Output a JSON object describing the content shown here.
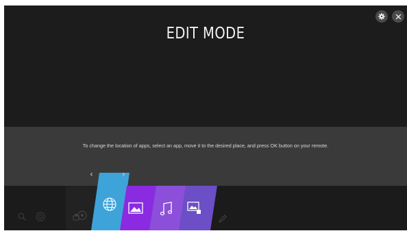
{
  "header": {
    "title": "EDIT MODE",
    "settings_icon": "gear-icon",
    "close_icon": "close-icon"
  },
  "instruction": {
    "text": "To change the location of apps, select an app, move it to the desired place, and press OK button on your remote."
  },
  "move_arrows": {
    "left": "‹",
    "right": "›"
  },
  "launcher": {
    "items": [
      {
        "name": "search",
        "icon": "search-icon"
      },
      {
        "name": "settings",
        "icon": "settings-circle-icon"
      },
      {
        "name": "inputs",
        "icon": "input-hub-icon"
      },
      {
        "name": "web-browser",
        "icon": "globe-icon",
        "color": "#3ea3d8",
        "selected": true
      },
      {
        "name": "photo-video",
        "icon": "image-icon",
        "color": "#8a2be2"
      },
      {
        "name": "music",
        "icon": "music-icon",
        "color": "#8b4fd9"
      },
      {
        "name": "gallery",
        "icon": "photo-gallery-icon",
        "color": "#6c4ec6"
      },
      {
        "name": "edit",
        "icon": "pencil-icon"
      }
    ]
  },
  "colors": {
    "background": "#1c1c1c",
    "instruction_band": "#3a3a3a",
    "launcher_bar": "#1b1b1b",
    "browser_card": "#3ea3d8",
    "photo_card": "#8a2be2",
    "music_card": "#8b4fd9",
    "gallery_card": "#6c4ec6"
  }
}
